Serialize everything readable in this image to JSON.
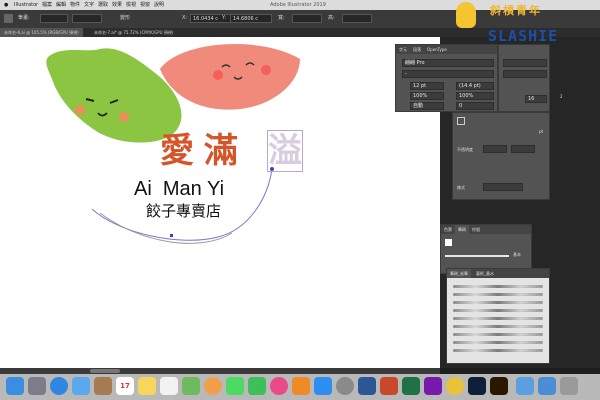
{
  "app": {
    "title": "Adobe Illustrator 2019"
  },
  "menubar": {
    "items": [
      "Illustrator",
      "檔案",
      "編輯",
      "物件",
      "文字",
      "選取",
      "效果",
      "檢視",
      "視窗",
      "說明"
    ]
  },
  "options": {
    "stroke_label": "筆畫:",
    "transform_label": "變形",
    "x_value": "16.0434 c",
    "y_value": "14.6806 c",
    "w_label": "寬:",
    "h_label": "高:"
  },
  "doc_tabs": [
    "未命名-6.ai @ 105.5% (RGB/GPU 預視)",
    "未命名-7.ai* @ 75.72% (CMYK/GPU 預視)"
  ],
  "canvas": {
    "logo_title": "愛滿",
    "logo_extra_char": "溢",
    "logo_english": "Ai  Man Yi",
    "logo_subtitle": "餃子專賣店"
  },
  "character_panel": {
    "tabs": [
      "字元",
      "段落",
      "OpenType"
    ],
    "font_family": "翩翩 Pro",
    "font_style": "-",
    "font_size": "12 pt",
    "leading": "(14.4 pt)",
    "h_scale": "100%",
    "v_scale": "100%",
    "tracking": "自動",
    "kerning": "0"
  },
  "right_panel": {
    "stroke_value": "pt",
    "value_16": "16",
    "value_2": "2",
    "label_opacity": "不透明度",
    "label_style": "樣式"
  },
  "swatch_panel": {
    "tabs": [
      "色票",
      "筆刷",
      "符號"
    ],
    "basic_label": "基本"
  },
  "brush_panel": {
    "tabs": [
      "筆刷_炭筆",
      "藝術_墨水"
    ]
  },
  "watermark": {
    "chinese": "斜槓青年",
    "english": "SLASHIE"
  },
  "dock": {
    "calendar_day": "17",
    "items": [
      "finder",
      "launchpad",
      "safari",
      "mail",
      "contacts",
      "calendar",
      "notes",
      "reminders",
      "maps",
      "photos",
      "messages",
      "facetime",
      "itunes",
      "ibooks",
      "app-store",
      "system-preferences",
      "word",
      "powerpoint",
      "excel",
      "onenote",
      "chrome",
      "photoshop",
      "illustrator",
      "folder",
      "downloads",
      "trash"
    ]
  },
  "colors": {
    "logo_orange": "#d5552b",
    "dumpling_green": "#8bc541",
    "dumpling_pink": "#f08a7a"
  }
}
